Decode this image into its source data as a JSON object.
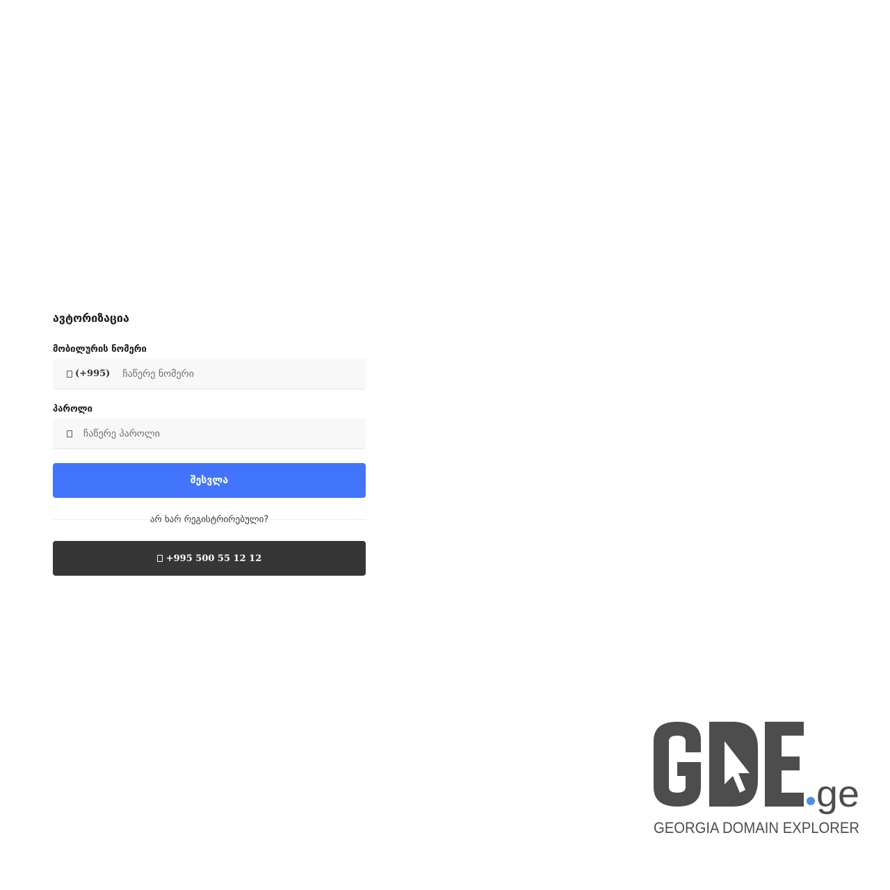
{
  "login": {
    "title": "ავტორიზაცია",
    "phone_label": "მობილურის ნომერი",
    "phone_prefix": "(+995)",
    "phone_placeholder": "ჩაწერე ნომერი",
    "password_label": "პაროლი",
    "password_placeholder": "ჩაწერე პაროლი",
    "submit_label": "შესვლა",
    "register_prompt": "არ ხარ რეგისტრირებული?",
    "phone_button_label": "+995 500 55 12 12"
  },
  "icons": {
    "phone_field": "phone-icon",
    "password_field": "lock-icon",
    "phone_button": "phone-icon"
  },
  "logo": {
    "main": "GDE",
    "tld": ".ge",
    "tagline": "GEORGIA DOMAIN EXPLORER"
  },
  "colors": {
    "primary": "#4274fb",
    "dark_button": "#363636",
    "logo_gray": "#4d4d4d",
    "logo_dot": "#4a90e2"
  }
}
